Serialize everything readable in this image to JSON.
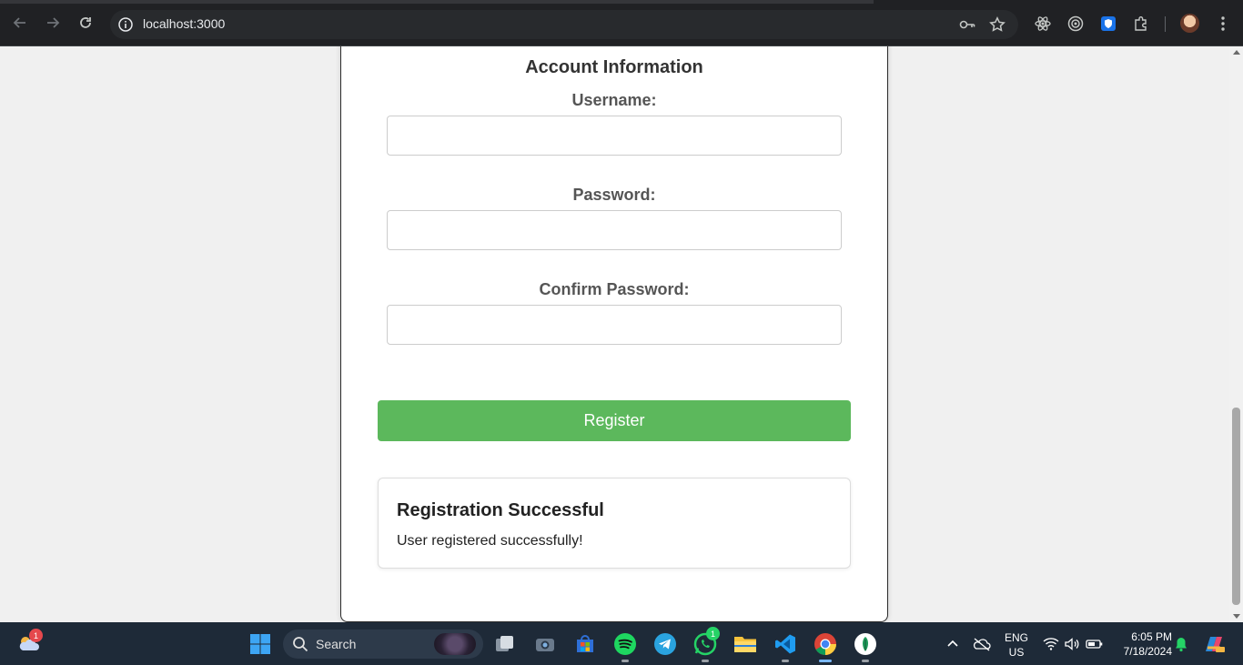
{
  "browser": {
    "url": "localhost:3000",
    "icons": [
      "back-icon",
      "forward-icon",
      "reload-icon",
      "site-info-icon",
      "password-key-icon",
      "bookmark-star-icon",
      "react-devtools-icon",
      "extension-circle-icon",
      "extension-shield-icon",
      "extensions-puzzle-icon",
      "profile-avatar",
      "more-menu-icon"
    ]
  },
  "form": {
    "section_title": "Account Information",
    "username_label": "Username:",
    "password_label": "Password:",
    "confirm_password_label": "Confirm Password:",
    "username_value": "",
    "password_value": "",
    "confirm_password_value": "",
    "register_label": "Register"
  },
  "result": {
    "title": "Registration Successful",
    "message": "User registered successfully!"
  },
  "colors": {
    "register_button": "#5cb85c",
    "chrome_dark": "#202124",
    "taskbar": "#1e2a38"
  },
  "taskbar": {
    "search_label": "Search",
    "weather_badge": "1",
    "whatsapp_badge": "1",
    "language_line1": "ENG",
    "language_line2": "US",
    "time": "6:05 PM",
    "date": "7/18/2024",
    "apps": [
      "widgets-weather-icon",
      "windows-start-icon",
      "search-icon",
      "task-view-icon",
      "camera-icon",
      "microsoft-store-icon",
      "spotify-icon",
      "telegram-icon",
      "whatsapp-icon",
      "file-explorer-icon",
      "vscode-icon",
      "chrome-icon",
      "app-leaf-icon"
    ]
  }
}
